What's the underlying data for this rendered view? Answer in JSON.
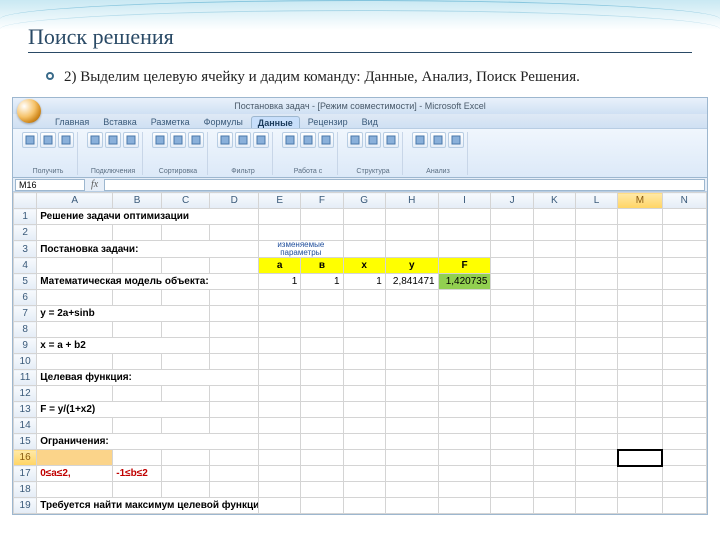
{
  "slide": {
    "title": "Поиск решения",
    "bullet": "2) Выделим целевую ячейку и дадим команду: Данные, Анализ, Поиск Решения."
  },
  "excel": {
    "window_title": "Постановка задач - [Режим совместимости] - Microsoft Excel",
    "tabs": [
      "Главная",
      "Вставка",
      "Разметка",
      "Формулы",
      "Данные",
      "Рецензир",
      "Вид"
    ],
    "active_tab": 4,
    "ribbon_groups": [
      "Получить",
      "Подключения",
      "Сортировка",
      "Фильтр",
      "Работа с",
      "Структура",
      "Анализ"
    ],
    "namebox": "M16",
    "columns": [
      "",
      "A",
      "B",
      "C",
      "D",
      "E",
      "F",
      "G",
      "H",
      "I",
      "J",
      "K",
      "L",
      "M",
      "N"
    ],
    "selected_col": "M",
    "selected_row": 16,
    "rows": {
      "1": {
        "A": "Решение задачи оптимизации"
      },
      "2": {},
      "3": {
        "A": "Постановка задачи:",
        "E_span": "изменяемые параметры"
      },
      "4": {
        "E": "a",
        "F": "в",
        "G": "x",
        "H": "y",
        "I": "F"
      },
      "5": {
        "A": "Математическая модель объекта:",
        "E": "1",
        "F": "1",
        "G": "1",
        "H": "2,841471",
        "I": "1,420735"
      },
      "6": {},
      "7": {
        "A": "y = 2a+sinb"
      },
      "8": {},
      "9": {
        "A": "x = a + b2"
      },
      "10": {},
      "11": {
        "A": "Целевая функция:"
      },
      "12": {},
      "13": {
        "A": "F = y/(1+x2)"
      },
      "14": {},
      "15": {
        "A": "Ограничения:"
      },
      "16": {},
      "17": {
        "A": "0≤a≤2,",
        "B": "-1≤b≤2"
      },
      "18": {},
      "19": {
        "A": "Требуется найти максимум целевой функции"
      }
    }
  }
}
